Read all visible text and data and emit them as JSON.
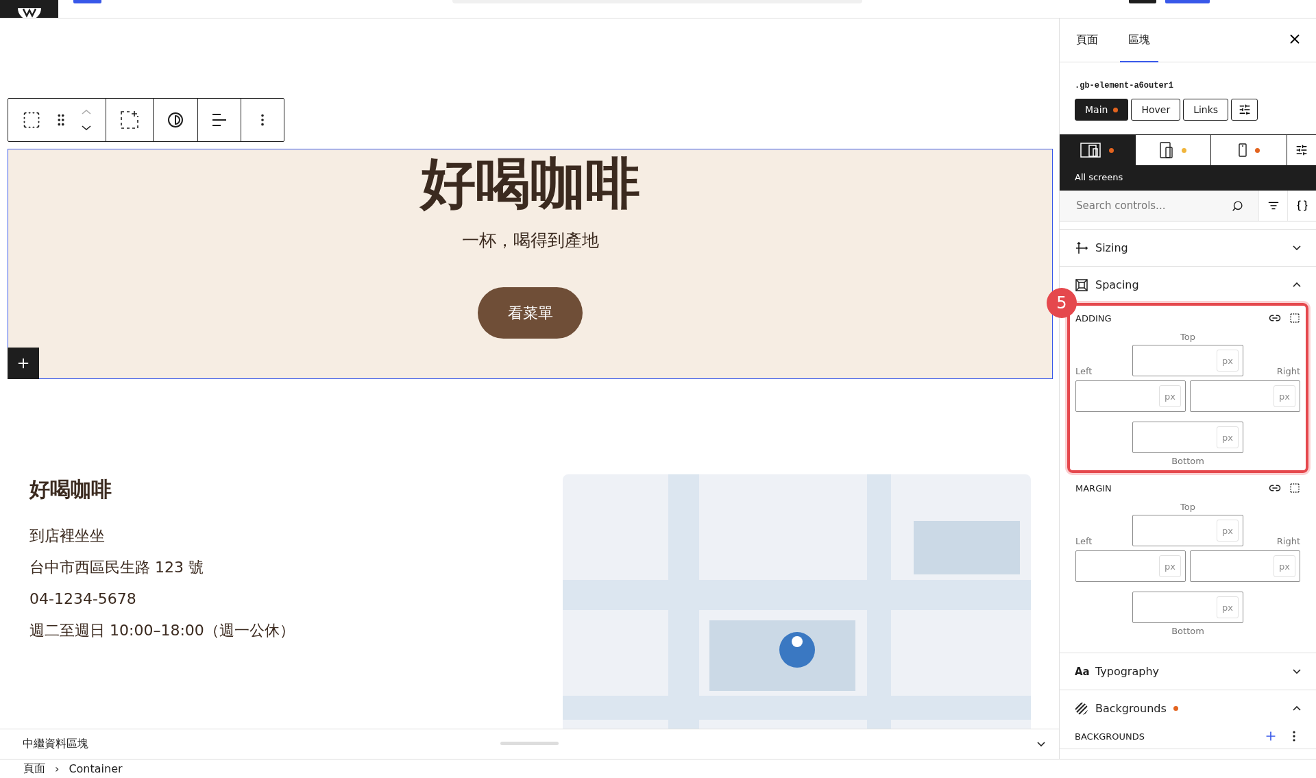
{
  "hero": {
    "title": "好喝咖啡",
    "subtitle": "一杯，喝得到產地",
    "button": "看菜單"
  },
  "info": {
    "heading": "好喝咖啡",
    "lines": [
      "到店裡坐坐",
      "台中市西區民生路 123 號",
      "04-1234-5678",
      "週二至週日 10:00–18:00（週一公休）"
    ]
  },
  "metadata_bar": {
    "label": "中繼資料區塊"
  },
  "breadcrumb": {
    "items": [
      "頁面",
      "Container"
    ],
    "separator": "›"
  },
  "sidebar": {
    "tabs": [
      {
        "label": "頁面",
        "selected": false
      },
      {
        "label": "區塊",
        "selected": true
      }
    ],
    "class_name": ".gb-element-a6outer1",
    "state_tabs": [
      {
        "label": "Main",
        "selected": true,
        "modified": true
      },
      {
        "label": "Hover",
        "selected": false,
        "modified": false
      },
      {
        "label": "Links",
        "selected": false,
        "modified": false
      }
    ],
    "devices": [
      {
        "kind": "desktop",
        "selected": true,
        "color": "#e3641f"
      },
      {
        "kind": "tablet",
        "selected": false,
        "color": "#f0b53c"
      },
      {
        "kind": "mobile",
        "selected": false,
        "color": "#e3641f"
      }
    ],
    "device_label": "All screens",
    "search": {
      "placeholder": "Search controls..."
    },
    "sections": [
      {
        "kind": "sizing",
        "title": "Sizing",
        "expanded": false,
        "modified": false
      },
      {
        "kind": "spacing",
        "title": "Spacing",
        "expanded": true,
        "modified": false,
        "groups": [
          {
            "label": "ADDING",
            "highlighted": true,
            "badge": "5",
            "fields": [
              {
                "label": "Top",
                "unit": "px"
              },
              {
                "label": "Left",
                "unit": "px"
              },
              {
                "label": "Right",
                "unit": "px"
              },
              {
                "label": "Bottom",
                "unit": "px"
              }
            ]
          },
          {
            "label": "MARGIN",
            "highlighted": false,
            "fields": [
              {
                "label": "Top",
                "unit": "px"
              },
              {
                "label": "Left",
                "unit": "px"
              },
              {
                "label": "Right",
                "unit": "px"
              },
              {
                "label": "Bottom",
                "unit": "px"
              }
            ]
          }
        ]
      },
      {
        "kind": "typography",
        "title": "Typography",
        "icon_text": "Aa",
        "expanded": false,
        "modified": false
      },
      {
        "kind": "backgrounds",
        "title": "Backgrounds",
        "expanded": true,
        "modified": true,
        "sublabel": "BACKGROUNDS"
      }
    ]
  }
}
